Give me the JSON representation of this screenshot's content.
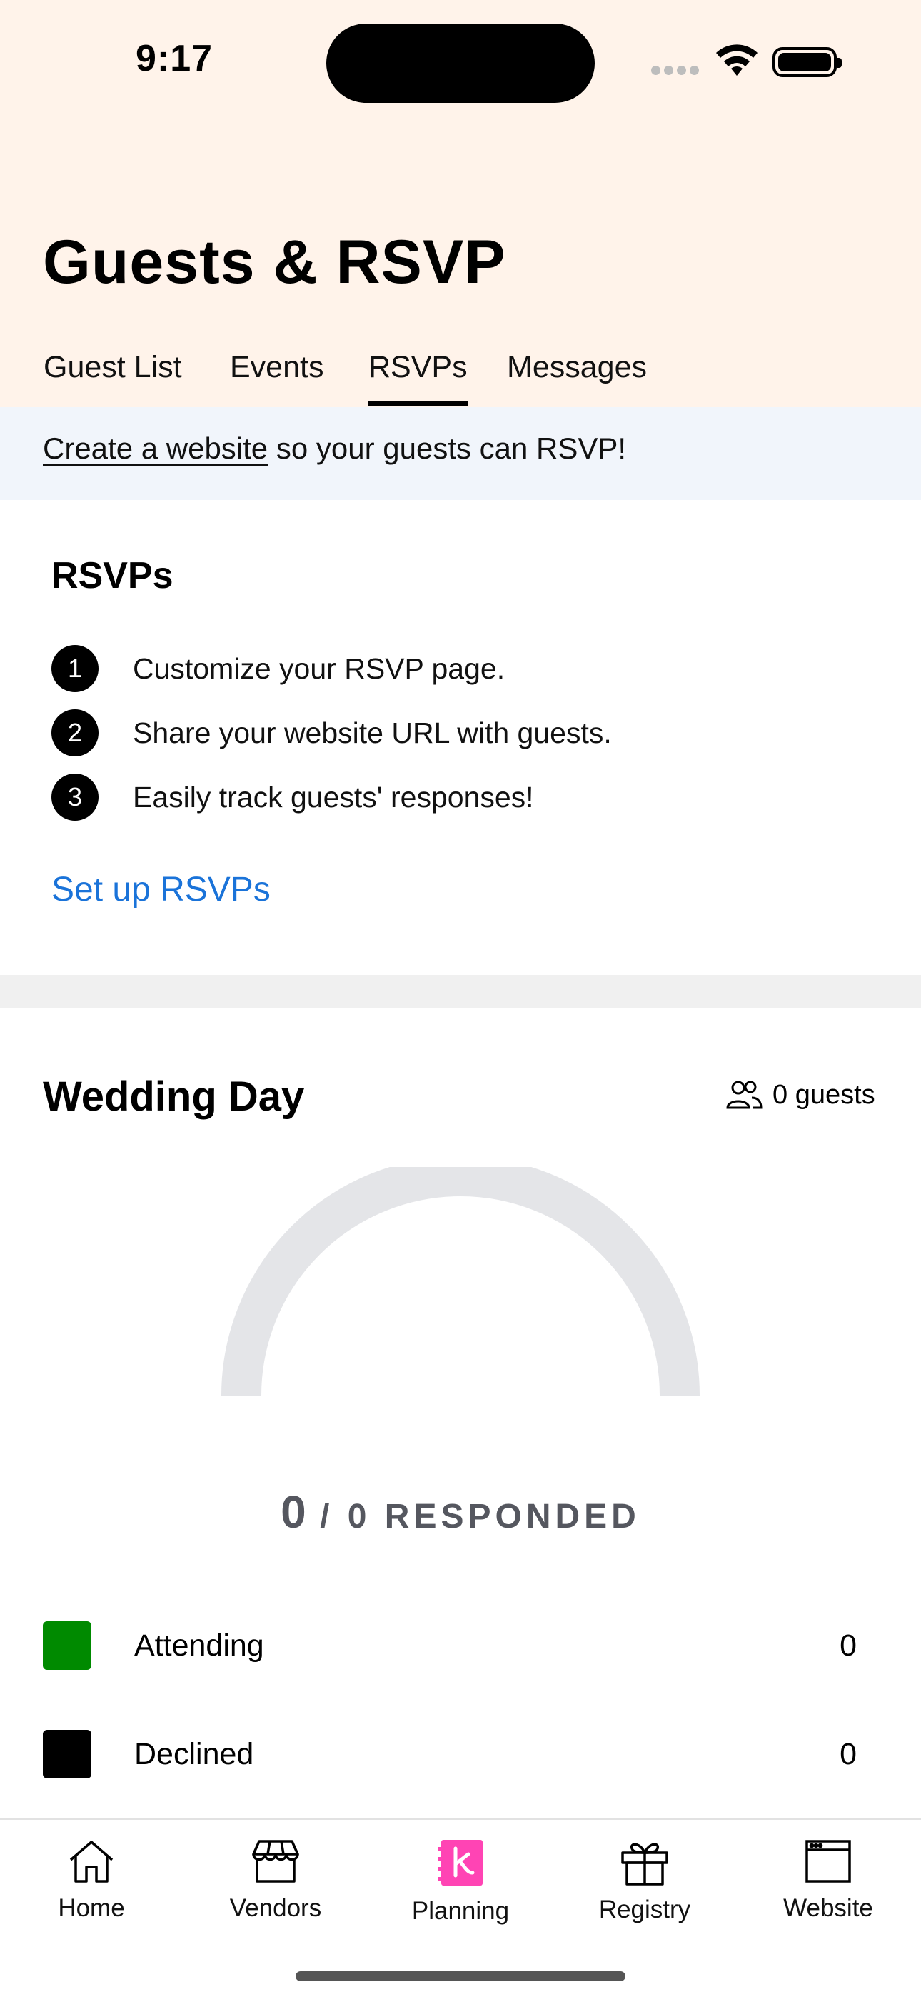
{
  "status_bar": {
    "time": "9:17"
  },
  "header": {
    "title": "Guests & RSVP"
  },
  "tabs": [
    {
      "label": "Guest List",
      "active": false
    },
    {
      "label": "Events",
      "active": false
    },
    {
      "label": "RSVPs",
      "active": true
    },
    {
      "label": "Messages",
      "active": false
    }
  ],
  "banner": {
    "link_text": "Create a website",
    "rest_text": " so your guests can RSVP!"
  },
  "rsvp_card": {
    "title": "RSVPs",
    "steps": [
      {
        "number": "1",
        "text": "Customize your RSVP page."
      },
      {
        "number": "2",
        "text": "Share your website URL with guests."
      },
      {
        "number": "3",
        "text": "Easily track guests' responses!"
      }
    ],
    "setup_link": "Set up RSVPs"
  },
  "wedding_day": {
    "title": "Wedding Day",
    "guest_count": "0 guests",
    "responded_count": "0",
    "responded_rest": " / 0 RESPONDED",
    "legend": [
      {
        "label": "Attending",
        "value": "0",
        "color": "#008a00"
      },
      {
        "label": "Declined",
        "value": "0",
        "color": "#000000"
      }
    ]
  },
  "bottom_nav": [
    {
      "label": "Home",
      "icon": "home-icon",
      "active": false
    },
    {
      "label": "Vendors",
      "icon": "storefront-icon",
      "active": false
    },
    {
      "label": "Planning",
      "icon": "planning-notebook-icon",
      "active": true
    },
    {
      "label": "Registry",
      "icon": "gift-icon",
      "active": false
    },
    {
      "label": "Website",
      "icon": "browser-window-icon",
      "active": false
    }
  ],
  "colors": {
    "header_bg": "#fff3ea",
    "banner_bg": "#f1f5fb",
    "link_blue": "#1a73d9",
    "planning_pink": "#ff44b4",
    "gauge_track": "#e4e5e8"
  }
}
